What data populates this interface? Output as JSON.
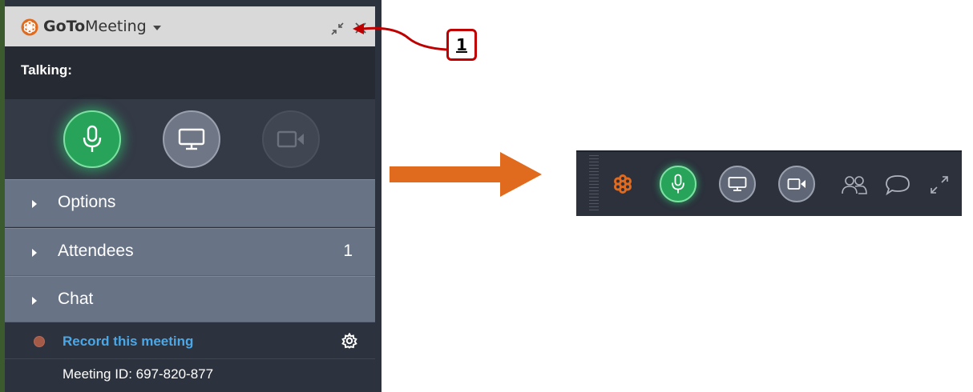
{
  "panel": {
    "brand_bold": "GoTo",
    "brand_rest": "Meeting",
    "talking_label": "Talking:",
    "sections": [
      {
        "label": "Options",
        "count": ""
      },
      {
        "label": "Attendees",
        "count": "1"
      },
      {
        "label": "Chat",
        "count": ""
      }
    ],
    "record_label": "Record this meeting",
    "meeting_id": "Meeting ID: 697-820-877"
  },
  "callout": {
    "number": "1"
  },
  "colors": {
    "accent_orange": "#e06a1e",
    "mic_green": "#27a35a",
    "callout_red": "#c00000",
    "link_blue": "#4aa8e8",
    "panel_dark": "#2d333e",
    "section_slate": "#687386"
  },
  "icons": {
    "title": [
      "gotomeeting-logo-icon",
      "chevron-down-icon",
      "collapse-icon",
      "close-icon"
    ],
    "controls": [
      "microphone-icon",
      "screen-share-icon",
      "camera-icon"
    ],
    "record": [
      "record-dot-icon",
      "gear-icon"
    ],
    "toolbar": [
      "gotomeeting-logo-icon",
      "microphone-icon",
      "screen-share-icon",
      "camera-icon",
      "attendees-icon",
      "chat-icon",
      "expand-icon"
    ]
  }
}
